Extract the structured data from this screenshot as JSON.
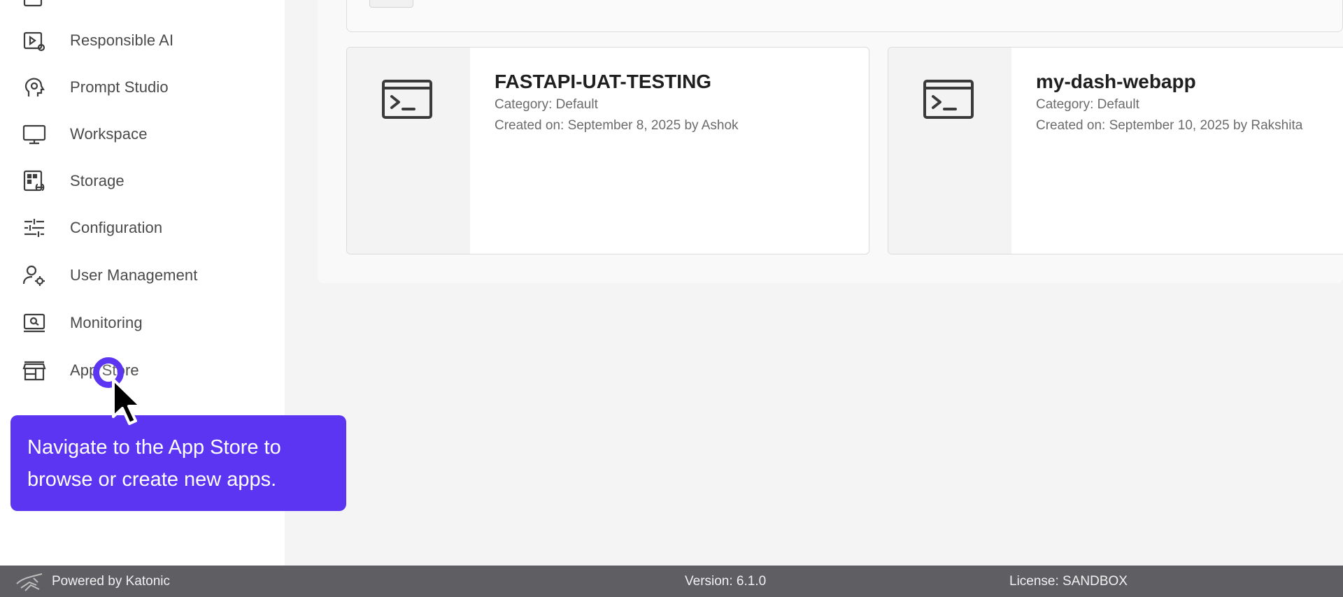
{
  "sidebar": {
    "items": [
      {
        "label": "",
        "icon": "partial-icon"
      },
      {
        "label": "Responsible AI",
        "icon": "responsible-ai-icon"
      },
      {
        "label": "Prompt Studio",
        "icon": "prompt-studio-icon"
      },
      {
        "label": "Workspace",
        "icon": "monitor-icon"
      },
      {
        "label": "Storage",
        "icon": "storage-icon"
      },
      {
        "label": "Configuration",
        "icon": "sliders-icon"
      },
      {
        "label": "User Management",
        "icon": "user-gear-icon"
      },
      {
        "label": "Monitoring",
        "icon": "monitoring-icon"
      },
      {
        "label": "App Store",
        "icon": "store-icon"
      }
    ]
  },
  "apps": [
    {
      "title": "FASTAPI-UAT-TESTING",
      "category": "Category: Default",
      "created": "Created on: September 8, 2025 by Ashok",
      "icon": "terminal-icon"
    },
    {
      "title": "my-dash-webapp",
      "category": "Category: Default",
      "created": "Created on: September 10, 2025 by Rakshita",
      "icon": "terminal-icon"
    }
  ],
  "tooltip": {
    "line1": "Navigate to the App Store to",
    "line2": "browse or create new apps."
  },
  "footer": {
    "powered": "Powered by Katonic",
    "version": "Version: 6.1.0",
    "license": "License: SANDBOX"
  },
  "colors": {
    "accent": "#5b35f2",
    "footer_bg": "#5f5f63",
    "sidebar_bg": "#ffffff",
    "main_bg": "#f4f4f5"
  }
}
